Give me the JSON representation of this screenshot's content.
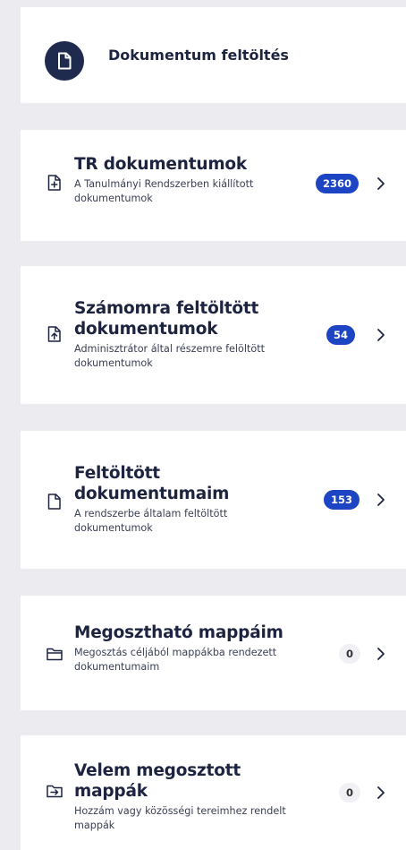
{
  "upload": {
    "title": "Dokumentum feltöltés",
    "icon": "document-icon"
  },
  "items": [
    {
      "title": "TR dokumentumok",
      "description": "A Tanulmányi Rendszerben kiállított dokumentumok",
      "count": "2360",
      "icon": "document-plus-icon"
    },
    {
      "title": "Számomra feltöltött dokumentumok",
      "description": "Adminisztrátor által részemre felöltött dokumentumok",
      "count": "54",
      "icon": "document-upload-icon"
    },
    {
      "title": "Feltöltött dokumentumaim",
      "description": "A rendszerbe általam feltöltött dokumentumok",
      "count": "153",
      "icon": "document-icon"
    },
    {
      "title": "Megosztható mappáim",
      "description": "Megosztás céljából mappákba rendezett dokumentumaim",
      "count": "0",
      "icon": "folder-icon"
    },
    {
      "title": "Velem megosztott mappák",
      "description": "Hozzám vagy közösségi tereimhez rendelt mappák",
      "count": "0",
      "icon": "shared-folder-icon"
    }
  ],
  "colors": {
    "background": "#ececf0",
    "card": "#ffffff",
    "navy": "#1f2a4f",
    "badge_blue": "#1c44c3",
    "badge_grey": "#f1f1f5"
  }
}
